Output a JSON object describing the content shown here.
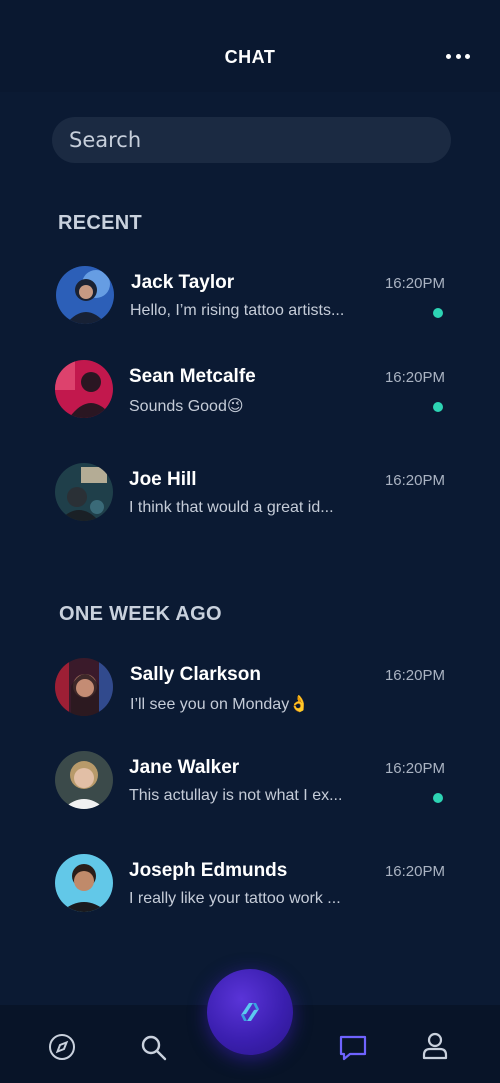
{
  "header": {
    "title": "CHAT",
    "more_icon": "more-horizontal-icon"
  },
  "search": {
    "placeholder": "Search"
  },
  "sections": {
    "recent": "RECENT",
    "week": "ONE WEEK AGO"
  },
  "recent": [
    {
      "name": "Jack Taylor",
      "time": "16:20PM",
      "preview": "Hello, I’m rising tattoo artists...",
      "unread": true
    },
    {
      "name": "Sean Metcalfe",
      "time": "16:20PM",
      "preview": "Sounds Good😉",
      "unread": true
    },
    {
      "name": "Joe Hill",
      "time": "16:20PM",
      "preview": "I think that would a great id...",
      "unread": false
    }
  ],
  "week": [
    {
      "name": "Sally Clarkson",
      "time": "16:20PM",
      "preview": "I’ll see you on Monday👌",
      "unread": false
    },
    {
      "name": "Jane Walker",
      "time": "16:20PM",
      "preview": "This actullay is not what I ex...",
      "unread": true
    },
    {
      "name": "Joseph  Edmunds",
      "time": "16:20PM",
      "preview": "I really like your tattoo work ...",
      "unread": false
    }
  ],
  "nav": {
    "explore_icon": "compass-icon",
    "search_icon": "search-icon",
    "center_icon": "link-icon",
    "chat_icon": "chat-bubble-icon",
    "profile_icon": "user-icon"
  },
  "colors": {
    "background": "#0b1a33",
    "unread": "#2dd4b4",
    "accent": "#4b2bd0",
    "active_nav": "#6f63ff"
  }
}
